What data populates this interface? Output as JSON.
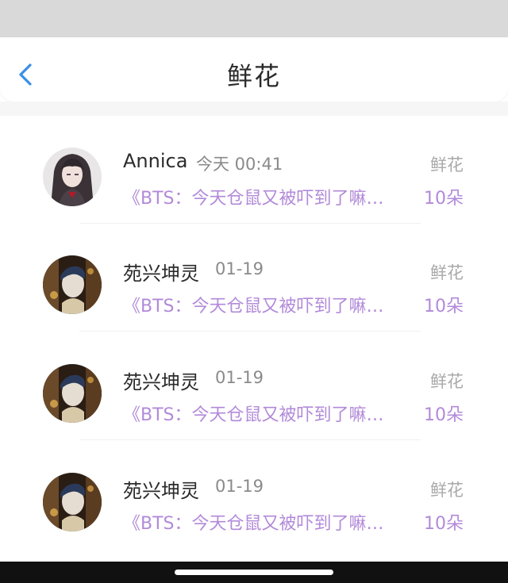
{
  "header": {
    "title": "鲜花",
    "back_icon": "chevron-left-icon",
    "accent_color": "#3a8ee6"
  },
  "colors": {
    "purple_text": "#b28ad9",
    "gray_text": "#8a8a8a"
  },
  "items": [
    {
      "name": "Annica",
      "time": "今天 00:41",
      "type": "鲜花",
      "book": "《BTS：今天仓鼠又被吓到了嘛…",
      "count": "10朵",
      "avatar": "anime-girl-avatar"
    },
    {
      "name": "苑兴坤灵",
      "time": "01-19",
      "type": "鲜花",
      "book": "《BTS：今天仓鼠又被吓到了嘛…",
      "count": "10朵",
      "avatar": "dark-ornate-avatar"
    },
    {
      "name": "苑兴坤灵",
      "time": "01-19",
      "type": "鲜花",
      "book": "《BTS：今天仓鼠又被吓到了嘛…",
      "count": "10朵",
      "avatar": "dark-ornate-avatar"
    },
    {
      "name": "苑兴坤灵",
      "time": "01-19",
      "type": "鲜花",
      "book": "《BTS：今天仓鼠又被吓到了嘛…",
      "count": "10朵",
      "avatar": "dark-ornate-avatar"
    }
  ]
}
